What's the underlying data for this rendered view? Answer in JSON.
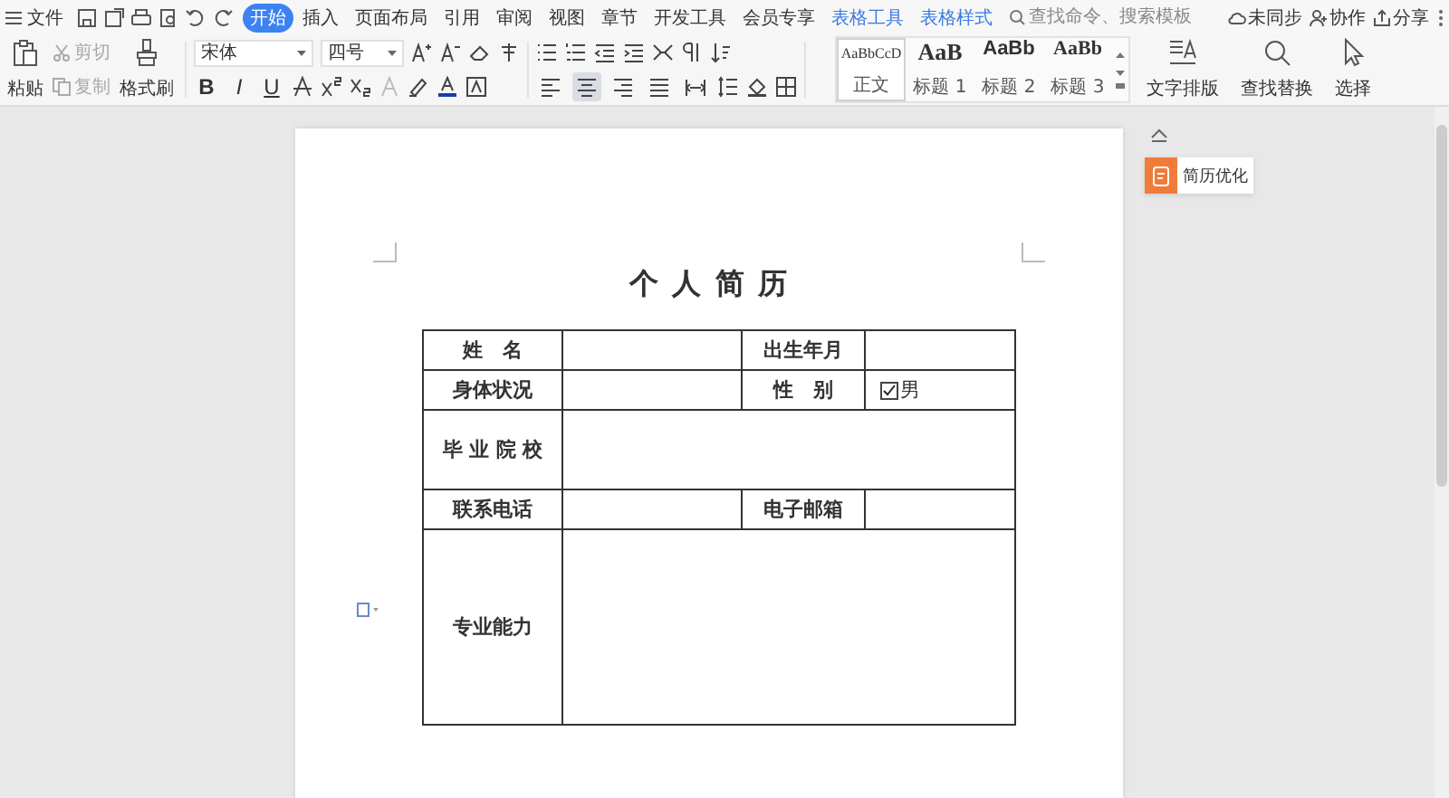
{
  "menubar": {
    "file_menu": "文件",
    "tabs": [
      {
        "label": "开始",
        "selected": true,
        "kind": "main"
      },
      {
        "label": "插入",
        "selected": false,
        "kind": "main"
      },
      {
        "label": "页面布局",
        "selected": false,
        "kind": "main"
      },
      {
        "label": "引用",
        "selected": false,
        "kind": "main"
      },
      {
        "label": "审阅",
        "selected": false,
        "kind": "main"
      },
      {
        "label": "视图",
        "selected": false,
        "kind": "main"
      },
      {
        "label": "章节",
        "selected": false,
        "kind": "main"
      },
      {
        "label": "开发工具",
        "selected": false,
        "kind": "main"
      },
      {
        "label": "会员专享",
        "selected": false,
        "kind": "main"
      },
      {
        "label": "表格工具",
        "selected": false,
        "kind": "context"
      },
      {
        "label": "表格样式",
        "selected": false,
        "kind": "context"
      }
    ],
    "search": {
      "placeholder": "查找命令、搜索模板"
    },
    "actions": [
      "未同步",
      "协作",
      "分享"
    ]
  },
  "ribbon": {
    "paste": "粘贴",
    "cut": {
      "label": "剪切",
      "disabled": true
    },
    "copy": {
      "label": "复制",
      "disabled": true
    },
    "format_painter": "格式刷",
    "font_name": "宋体",
    "font_size": "四号",
    "format_buttons": [
      "B",
      "I",
      "U"
    ],
    "alignment": [
      {
        "selected": false
      },
      {
        "selected": true
      },
      {
        "selected": false
      },
      {
        "selected": false
      },
      {
        "selected": false
      }
    ],
    "styles": [
      {
        "sample": "AaBbCcD",
        "label": "正文",
        "selected": true,
        "kind": "body"
      },
      {
        "sample": "AaB",
        "label": "标题 1",
        "selected": false,
        "kind": "h1"
      },
      {
        "sample": "AaBb",
        "label": "标题 2",
        "selected": false,
        "kind": "h2"
      },
      {
        "sample": "AaBb",
        "label": "标题 3",
        "selected": false,
        "kind": "h3"
      }
    ],
    "tools": [
      "文字排版",
      "查找替换",
      "选择"
    ]
  },
  "document": {
    "title": "个 人 简 历",
    "rows": [
      [
        {
          "text": "姓　名",
          "kind": "label"
        },
        {
          "text": "",
          "kind": "value"
        },
        {
          "text": "出生年月",
          "kind": "label"
        },
        {
          "text": "",
          "kind": "value"
        }
      ],
      [
        {
          "text": "身体状况",
          "kind": "label"
        },
        {
          "text": "",
          "kind": "value"
        },
        {
          "text": "性　别",
          "kind": "label"
        },
        {
          "text": "男",
          "kind": "checkbox",
          "checked": true
        }
      ],
      [
        {
          "text": "毕 业 院 校",
          "kind": "label"
        },
        {
          "text": "",
          "kind": "wide"
        }
      ],
      [
        {
          "text": "联系电话",
          "kind": "label"
        },
        {
          "text": "",
          "kind": "value"
        },
        {
          "text": "电子邮箱",
          "kind": "label"
        },
        {
          "text": "",
          "kind": "value"
        }
      ],
      [
        {
          "text": "专业能力",
          "kind": "label"
        },
        {
          "text": "",
          "kind": "tall"
        }
      ]
    ]
  },
  "sidebar": {
    "button": "简历优化"
  }
}
